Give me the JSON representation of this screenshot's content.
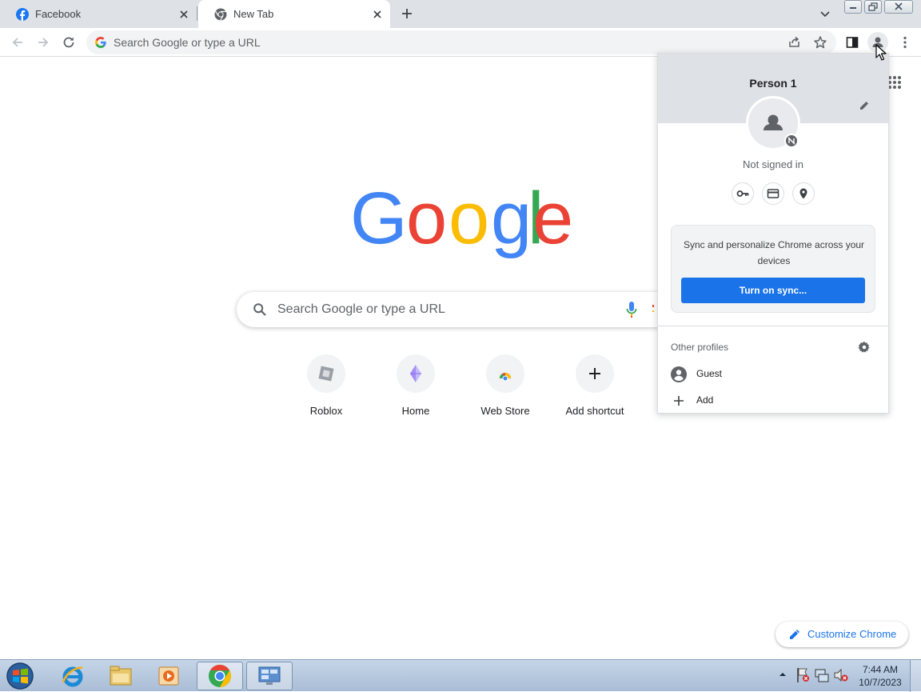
{
  "tabs": [
    {
      "label": "Facebook",
      "icon": "facebook-icon"
    },
    {
      "label": "New Tab",
      "icon": "chrome-icon"
    }
  ],
  "omnibox": {
    "placeholder": "Search Google or type a URL"
  },
  "ntp": {
    "search_placeholder": "Search Google or type a URL",
    "shortcuts": [
      {
        "label": "Roblox",
        "icon": "roblox-icon"
      },
      {
        "label": "Home",
        "icon": "home-shortcut-icon"
      },
      {
        "label": "Web Store",
        "icon": "webstore-icon"
      },
      {
        "label": "Add shortcut",
        "icon": "plus-icon"
      }
    ],
    "customize_label": "Customize Chrome"
  },
  "profile_menu": {
    "name": "Person 1",
    "status": "Not signed in",
    "sync_text": "Sync and personalize Chrome across your devices",
    "sync_button": "Turn on sync...",
    "other_profiles_label": "Other profiles",
    "guest_label": "Guest",
    "add_label": "Add"
  },
  "taskbar": {
    "time": "7:44 AM",
    "date": "10/7/2023"
  },
  "colors": {
    "accent": "#1a73e8",
    "tabstrip": "#dee1e6",
    "facebook_blue": "#1877f2"
  }
}
